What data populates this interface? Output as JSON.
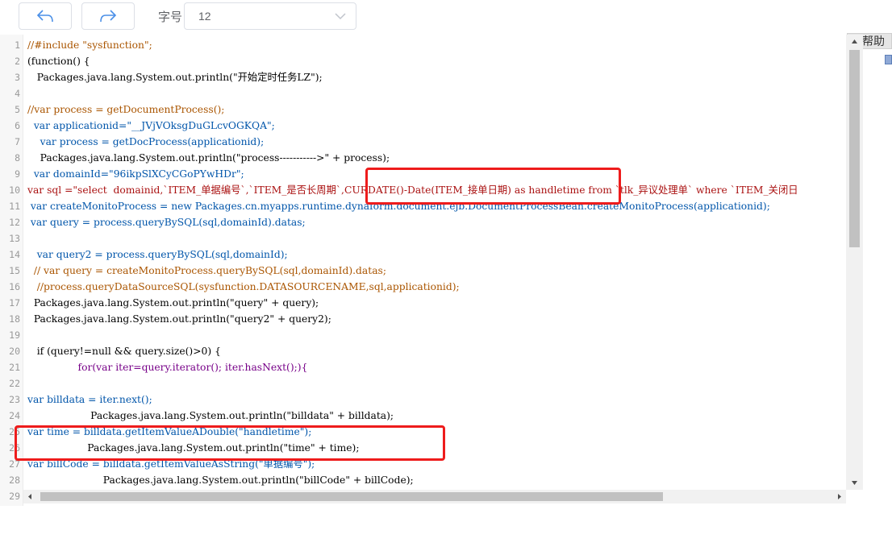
{
  "toolbar": {
    "undo_icon": "undo-icon",
    "redo_icon": "redo-icon",
    "font_size_label": "字号",
    "font_size_value": "12"
  },
  "side": {
    "help_label": "帮助"
  },
  "editor": {
    "line_numbers": [
      "1",
      "2",
      "3",
      "4",
      "5",
      "6",
      "7",
      "8",
      "9",
      "10",
      "11",
      "12",
      "13",
      "14",
      "15",
      "16",
      "17",
      "18",
      "19",
      "20",
      "21",
      "22",
      "23",
      "24",
      "25",
      "26",
      "27",
      "28",
      "29"
    ],
    "lines": [
      "//#include \"sysfunction\";",
      "(function() {",
      "   Packages.java.lang.System.out.println(\"开始定时任务LZ\");",
      "",
      "//var process = getDocumentProcess();",
      "  var applicationid=\"__JVjVOksgDuGLcvOGKQA\";",
      "    var process = getDocProcess(applicationid);",
      "    Packages.java.lang.System.out.println(\"process----------->\" + process);",
      "  var domainId=\"96ikpSlXCyCGoPYwHDr\";",
      "var sql =\"select  domainid,`ITEM_单据编号`,`ITEM_是否长周期`,CURDATE()-Date(ITEM_接单日期) as handletime from `tlk_异议处理单` where `ITEM_关闭日",
      " var createMonitoProcess = new Packages.cn.myapps.runtime.dynaform.document.ejb.DocumentProcessBean.createMonitoProcess(applicationid);",
      " var query = process.queryBySQL(sql,domainId).datas;",
      "",
      "   var query2 = process.queryBySQL(sql,domainId);",
      "  // var query = createMonitoProcess.queryBySQL(sql,domainId).datas;",
      "   //process.queryDataSourceSQL(sysfunction.DATASOURCENAME,sql,applicationid);",
      "  Packages.java.lang.System.out.println(\"query\" + query);",
      "  Packages.java.lang.System.out.println(\"query2\" + query2);",
      "",
      "   if (query!=null && query.size()>0) {",
      "                for(var iter=query.iterator(); iter.hasNext();){",
      "",
      "var billdata = iter.next();",
      "                    Packages.java.lang.System.out.println(\"billdata\" + billdata);",
      "var time = billdata.getItemValueADouble(\"handletime\");",
      "                   Packages.java.lang.System.out.println(\"time\" + time);",
      "var billCode = billdata.getItemValueAsString(\"单据编号\");",
      "                        Packages.java.lang.System.out.println(\"billCode\" + billCode);",
      ""
    ]
  },
  "colors": {
    "highlight": "#ee1c1c",
    "comment": "#aa5500",
    "keyword": "#770088",
    "string": "#aa1111",
    "def": "#0055aa"
  }
}
